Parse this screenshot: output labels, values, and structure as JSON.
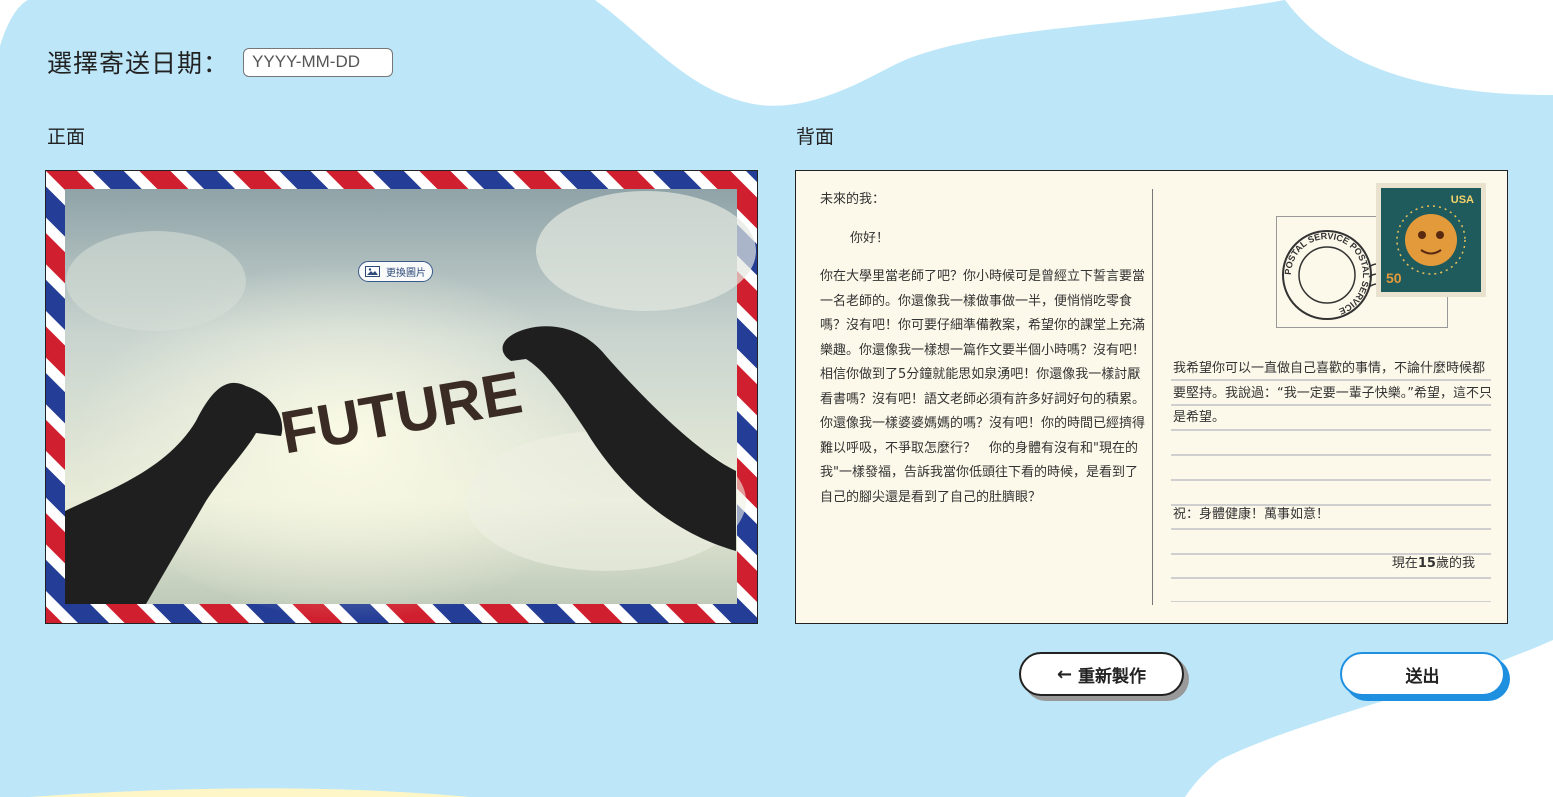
{
  "date": {
    "label": "選擇寄送日期：",
    "placeholder": "YYYY-MM-DD"
  },
  "front": {
    "title": "正面",
    "change_image_label": "更換圖片",
    "photo_word": "FUTURE"
  },
  "back": {
    "title": "背面",
    "greeting": "未來的我：",
    "hello": "你好！",
    "body": "你在大學里當老師了吧？你小時候可是曾經立下誓言要當一名老師的。你還像我一樣做事做一半，便悄悄吃零食嗎？沒有吧！你可要仔細準備教案，希望你的課堂上充滿樂趣。你還像我一樣想一篇作文要半個小時嗎？沒有吧！相信你做到了5分鐘就能思如泉湧吧！你還像我一樣討厭看書嗎？沒有吧！語文老師必須有許多好詞好句的積累。你還像我一樣婆婆媽媽的嗎？沒有吧！你的時間已經擠得難以呼吸，不爭取怎麼行？　你的身體有沒有和\"現在的我\"一樣發福，告訴我當你低頭往下看的時候，是看到了自己的腳尖還是看到了自己的肚臍眼？",
    "wish": "我希望你可以一直做自己喜歡的事情，不論什麼時候都要堅持。我說過：“我一定要一輩子快樂。”希望，這不只是希望。",
    "signoff": "祝：身體健康！萬事如意！",
    "signature_prefix": "現在",
    "signature_age": "15",
    "signature_suffix": "歲的我",
    "stamp_country": "USA",
    "stamp_value": "50",
    "postmark_text": "POSTAL SERVICE POSTAL SERVICE"
  },
  "buttons": {
    "redo_label": "重新製作",
    "send_label": "送出"
  },
  "colors": {
    "background_blob": "#bde7f8",
    "airmail_red": "#d01f2e",
    "airmail_blue": "#243d96",
    "send_accent": "#1f8fe0",
    "card_paper": "#fdf9ea"
  },
  "icons": {
    "change_image": "image-icon",
    "redo": "arrow-left-icon"
  }
}
